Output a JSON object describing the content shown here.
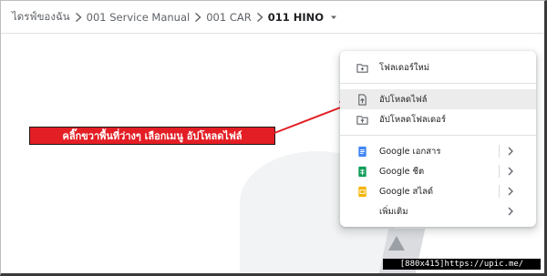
{
  "breadcrumb": {
    "items": [
      {
        "label": "ไดรฟ์ของฉัน"
      },
      {
        "label": "001 Service Manual"
      },
      {
        "label": "001 CAR"
      },
      {
        "label": "011 HINO"
      }
    ]
  },
  "callout": {
    "text": "คลิ๊กขวาพื้นที่ว่างๆ เลือกเมนู อัปโหลดไฟล์",
    "color": "#e31e24"
  },
  "context_menu": {
    "new_folder": {
      "label": "โฟลเดอร์ใหม่",
      "icon": "new-folder-icon"
    },
    "upload_file": {
      "label": "อัปโหลดไฟล์",
      "icon": "upload-file-icon",
      "highlighted": true
    },
    "upload_folder": {
      "label": "อัปโหลดโฟลเดอร์",
      "icon": "upload-folder-icon"
    },
    "google_docs": {
      "label": "Google เอกสาร",
      "icon": "google-docs-icon",
      "color": "#4285f4"
    },
    "google_sheets": {
      "label": "Google ชีต",
      "icon": "google-sheets-icon",
      "color": "#0f9d58"
    },
    "google_slides": {
      "label": "Google สไลด์",
      "icon": "google-slides-icon",
      "color": "#f4b400"
    },
    "more": {
      "label": "เพิ่มเติม"
    }
  },
  "watermark": {
    "text": "[880x415]https://upic.me/"
  }
}
